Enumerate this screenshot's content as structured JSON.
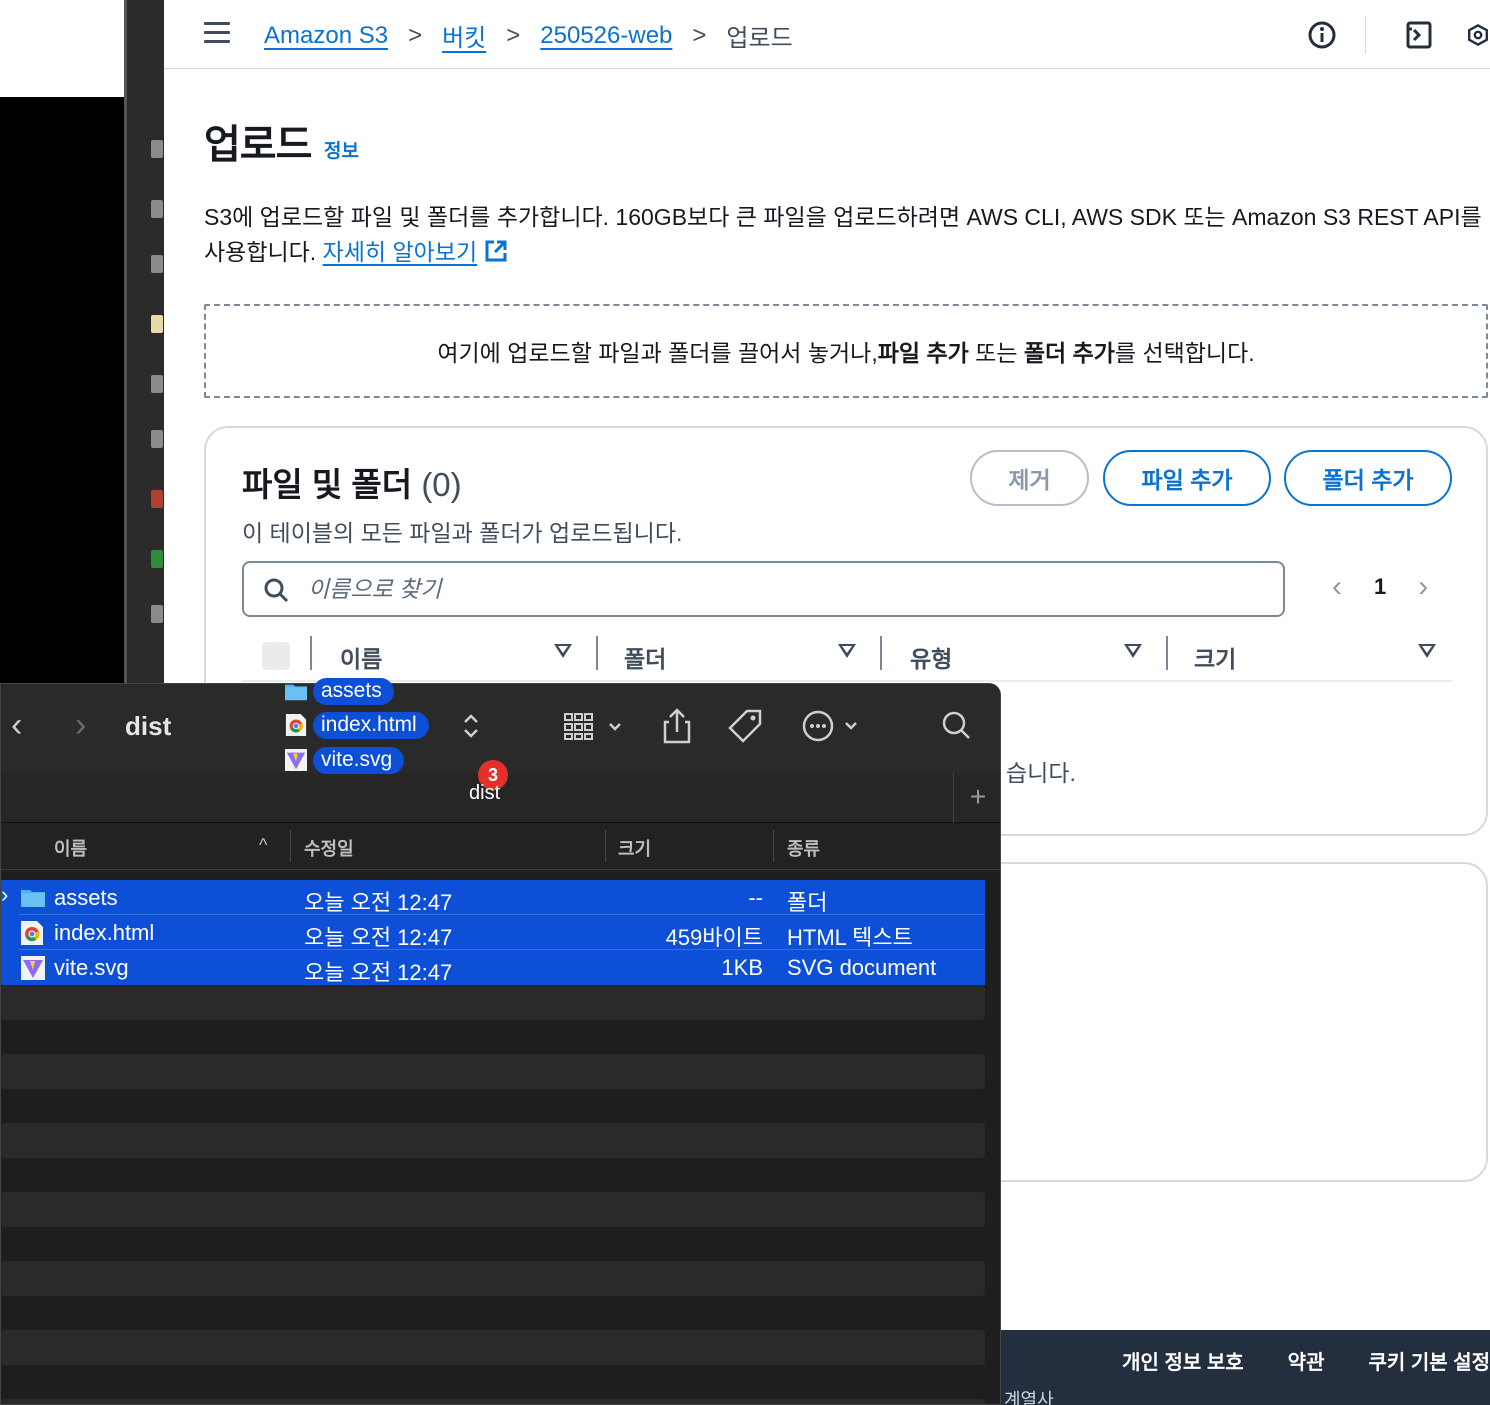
{
  "breadcrumb": {
    "items": [
      "Amazon S3",
      "버킷",
      "250526-web"
    ],
    "current": "업로드",
    "separator": ">"
  },
  "page": {
    "title": "업로드",
    "info_link": "정보",
    "description": "S3에 업로드할 파일 및 폴더를 추가합니다. 160GB보다 큰 파일을 업로드하려면 AWS CLI, AWS SDK 또는 Amazon S3 REST API를 사용합니다.",
    "learn_more": "자세히 알아보기"
  },
  "dropzone": {
    "prefix": "여기에 업로드할 파일과 폴더를 끌어서 놓거나, ",
    "add_files": "파일 추가",
    "middle": " 또는 ",
    "add_folder": "폴더 추가",
    "suffix": "를 선택합니다."
  },
  "files_panel": {
    "title": "파일 및 폴더",
    "count": "(0)",
    "subtitle": "이 테이블의 모든 파일과 폴더가 업로드됩니다.",
    "remove_button": "제거",
    "add_files_button": "파일 추가",
    "add_folder_button": "폴더 추가",
    "search_placeholder": "이름으로 찾기",
    "page_number": "1",
    "columns": [
      "이름",
      "폴더",
      "유형",
      "크기"
    ],
    "empty_fragment": "습니다."
  },
  "footer": {
    "links": [
      "개인 정보 보호",
      "약관",
      "쿠키 기본 설정"
    ],
    "affiliates": "계열사"
  },
  "finder": {
    "title": "dist",
    "columns": {
      "name": "이름",
      "modified": "수정일",
      "size": "크기",
      "kind": "종류"
    },
    "rows": [
      {
        "name": "assets",
        "modified": "오늘 오전 12:47",
        "size": "--",
        "kind": "폴더",
        "icon": "folder-icon"
      },
      {
        "name": "index.html",
        "modified": "오늘 오전 12:47",
        "size": "459바이트",
        "kind": "HTML 텍스트",
        "icon": "chrome-file-icon"
      },
      {
        "name": "vite.svg",
        "modified": "오늘 오전 12:47",
        "size": "1KB",
        "kind": "SVG document",
        "icon": "vite-icon"
      }
    ],
    "plus": "+"
  },
  "drag": {
    "items": [
      "assets",
      "index.html",
      "vite.svg"
    ],
    "count_badge": "3",
    "label": "dist"
  },
  "colors": {
    "aws_link": "#0972d3",
    "finder_selection": "#0d4fd6",
    "footer_bg": "#232f3e",
    "badge": "#e5302a"
  }
}
